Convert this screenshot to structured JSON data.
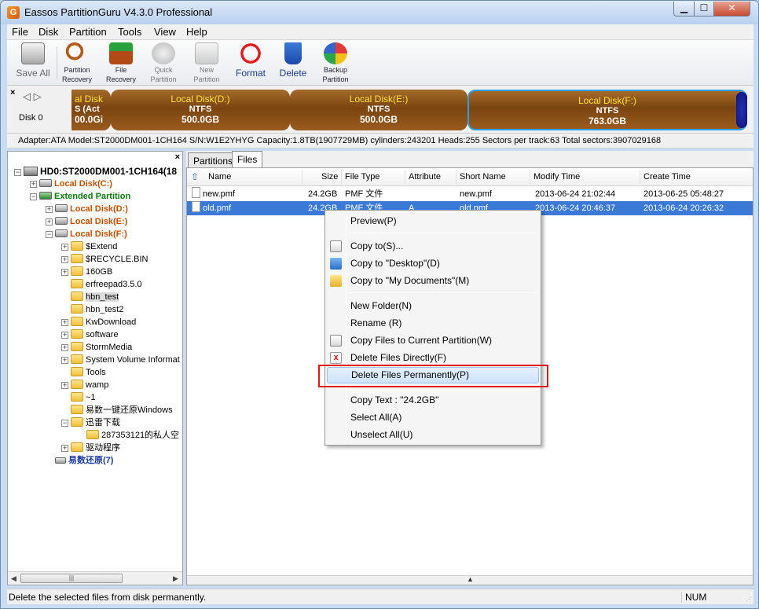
{
  "window": {
    "title": "Eassos PartitionGuru V4.3.0 Professional",
    "app_icon_glyph": "G",
    "min_glyph": "▁",
    "max_glyph": "☐",
    "close_glyph": "✕"
  },
  "menu": [
    "File",
    "Disk",
    "Partition",
    "Tools",
    "View",
    "Help"
  ],
  "toolbar": {
    "save_all": "Save All",
    "partition_recovery": [
      "Partition",
      "Recovery"
    ],
    "file_recovery": [
      "File",
      "Recovery"
    ],
    "quick_partition": [
      "Quick",
      "Partition"
    ],
    "new_partition": [
      "New",
      "Partition"
    ],
    "format": "Format",
    "delete": "Delete",
    "backup_partition": [
      "Backup",
      "Partition"
    ]
  },
  "diskbar": {
    "close_glyph": "×",
    "nav_glyphs": "◁ ▷",
    "disk_label": "Disk  0",
    "partitions": [
      {
        "name": "al Disk",
        "fs": "S (Act",
        "size": "00.0Gi"
      },
      {
        "name": "Local Disk(D:)",
        "fs": "NTFS",
        "size": "500.0GB"
      },
      {
        "name": "Local Disk(E:)",
        "fs": "NTFS",
        "size": "500.0GB"
      },
      {
        "name": "Local Disk(F:)",
        "fs": "NTFS",
        "size": "763.0GB"
      }
    ]
  },
  "info": "Adapter:ATA  Model:ST2000DM001-1CH164  S/N:W1E2YHYG  Capacity:1.8TB(1907729MB)  cylinders:243201  Heads:255  Sectors per track:63  Total sectors:3907029168",
  "tree": {
    "close_glyph": "×",
    "hd": "HD0:ST2000DM001-1CH164(18",
    "local_c": "Local Disk(C:)",
    "extended": "Extended Partition",
    "local_d": "Local Disk(D:)",
    "local_e": "Local Disk(E:)",
    "local_f": "Local Disk(F:)",
    "folders": [
      "$Extend",
      "$RECYCLE.BIN",
      "160GB",
      "erfreepad3.5.0",
      "hbn_test",
      "hbn_test2",
      "KwDownload",
      "software",
      "StormMedia",
      "System Volume Informat",
      "Tools",
      "wamp",
      "~1",
      "易数一键还原Windows",
      "迅雷下载"
    ],
    "subfolder": "287353121的私人空",
    "last_folder": "驱动程序",
    "restore": "易数还原(7)",
    "scroll_left": "◀",
    "scroll_right": "▶",
    "thumb_grip": "|||"
  },
  "tabs": {
    "partitions": "Partitions",
    "files": "Files"
  },
  "columns": {
    "up_glyph": "⇧",
    "name": "Name",
    "size": "Size",
    "file_type": "File Type",
    "attribute": "Attribute",
    "short_name": "Short Name",
    "modify_time": "Modify Time",
    "create_time": "Create Time"
  },
  "files": [
    {
      "name": "new.pmf",
      "size": "24.2GB",
      "type": "PMF 文件",
      "attr": "",
      "short": "new.pmf",
      "modified": "2013-06-24 21:02:44",
      "created": "2013-06-25 05:48:27"
    },
    {
      "name": "old.pmf",
      "size": "24.2GB",
      "type": "PMF 文件",
      "attr": "A",
      "short": "old.pmf",
      "modified": "2013-06-24 20:46:37",
      "created": "2013-06-24 20:26:32"
    }
  ],
  "split_glyph": "▲",
  "context_menu": {
    "preview": "Preview(P)",
    "copy_to": "Copy to(S)...",
    "copy_desktop": "Copy to \"Desktop\"(D)",
    "copy_docs": "Copy to \"My Documents\"(M)",
    "new_folder": "New Folder(N)",
    "rename": "Rename (R)",
    "copy_current": "Copy Files to Current Partition(W)",
    "delete_directly": "Delete Files Directly(F)",
    "delete_permanently": "Delete Files Permanently(P)",
    "copy_text": "Copy Text : \"24.2GB\"",
    "select_all": "Select All(A)",
    "unselect_all": "Unselect All(U)"
  },
  "status": {
    "text": "Delete the selected files from disk permanently.",
    "num": "NUM",
    "grip_glyph": "⋰"
  }
}
